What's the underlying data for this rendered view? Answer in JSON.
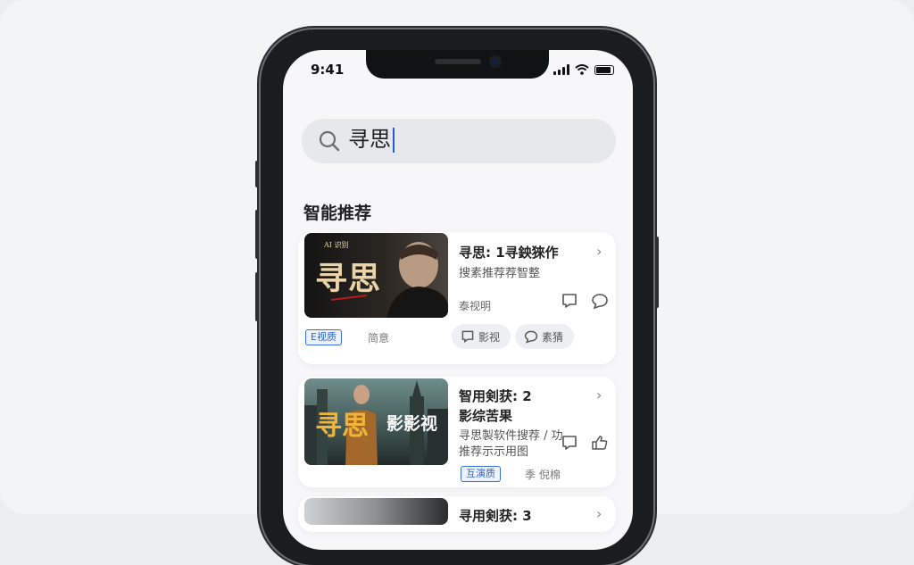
{
  "status_bar": {
    "time": "9:41"
  },
  "search": {
    "query": "寻思"
  },
  "section_title": "智能推荐",
  "cards": [
    {
      "thumb_title_small": "AI 识别",
      "thumb_title": "寻思",
      "title": "寻思: 1寻鉠猍作",
      "subtitle": "搜素推荐荐智整",
      "meta": "泰视明",
      "tag": "E视质",
      "plain": "简意",
      "pills": [
        "影视",
        "素猜"
      ]
    },
    {
      "thumb_title": "寻思",
      "thumb_title_2": "影影视",
      "title_line1": "智用剣获: 2",
      "title_line2": "影综苦果",
      "sub_line1": "寻思製软件搜荐 / 功",
      "sub_line2": "推荐示示用图",
      "tag": "互演质",
      "plain": "季 倪棉"
    },
    {
      "title": "寻用剣获: 3"
    }
  ],
  "colors": {
    "accent": "#2a5bd7",
    "screen_bg": "#f7f7f9",
    "card_bg": "#ffffff"
  },
  "icons": [
    "search-icon",
    "chevron-right-icon",
    "bookmark-icon",
    "comment-icon",
    "like-icon"
  ]
}
